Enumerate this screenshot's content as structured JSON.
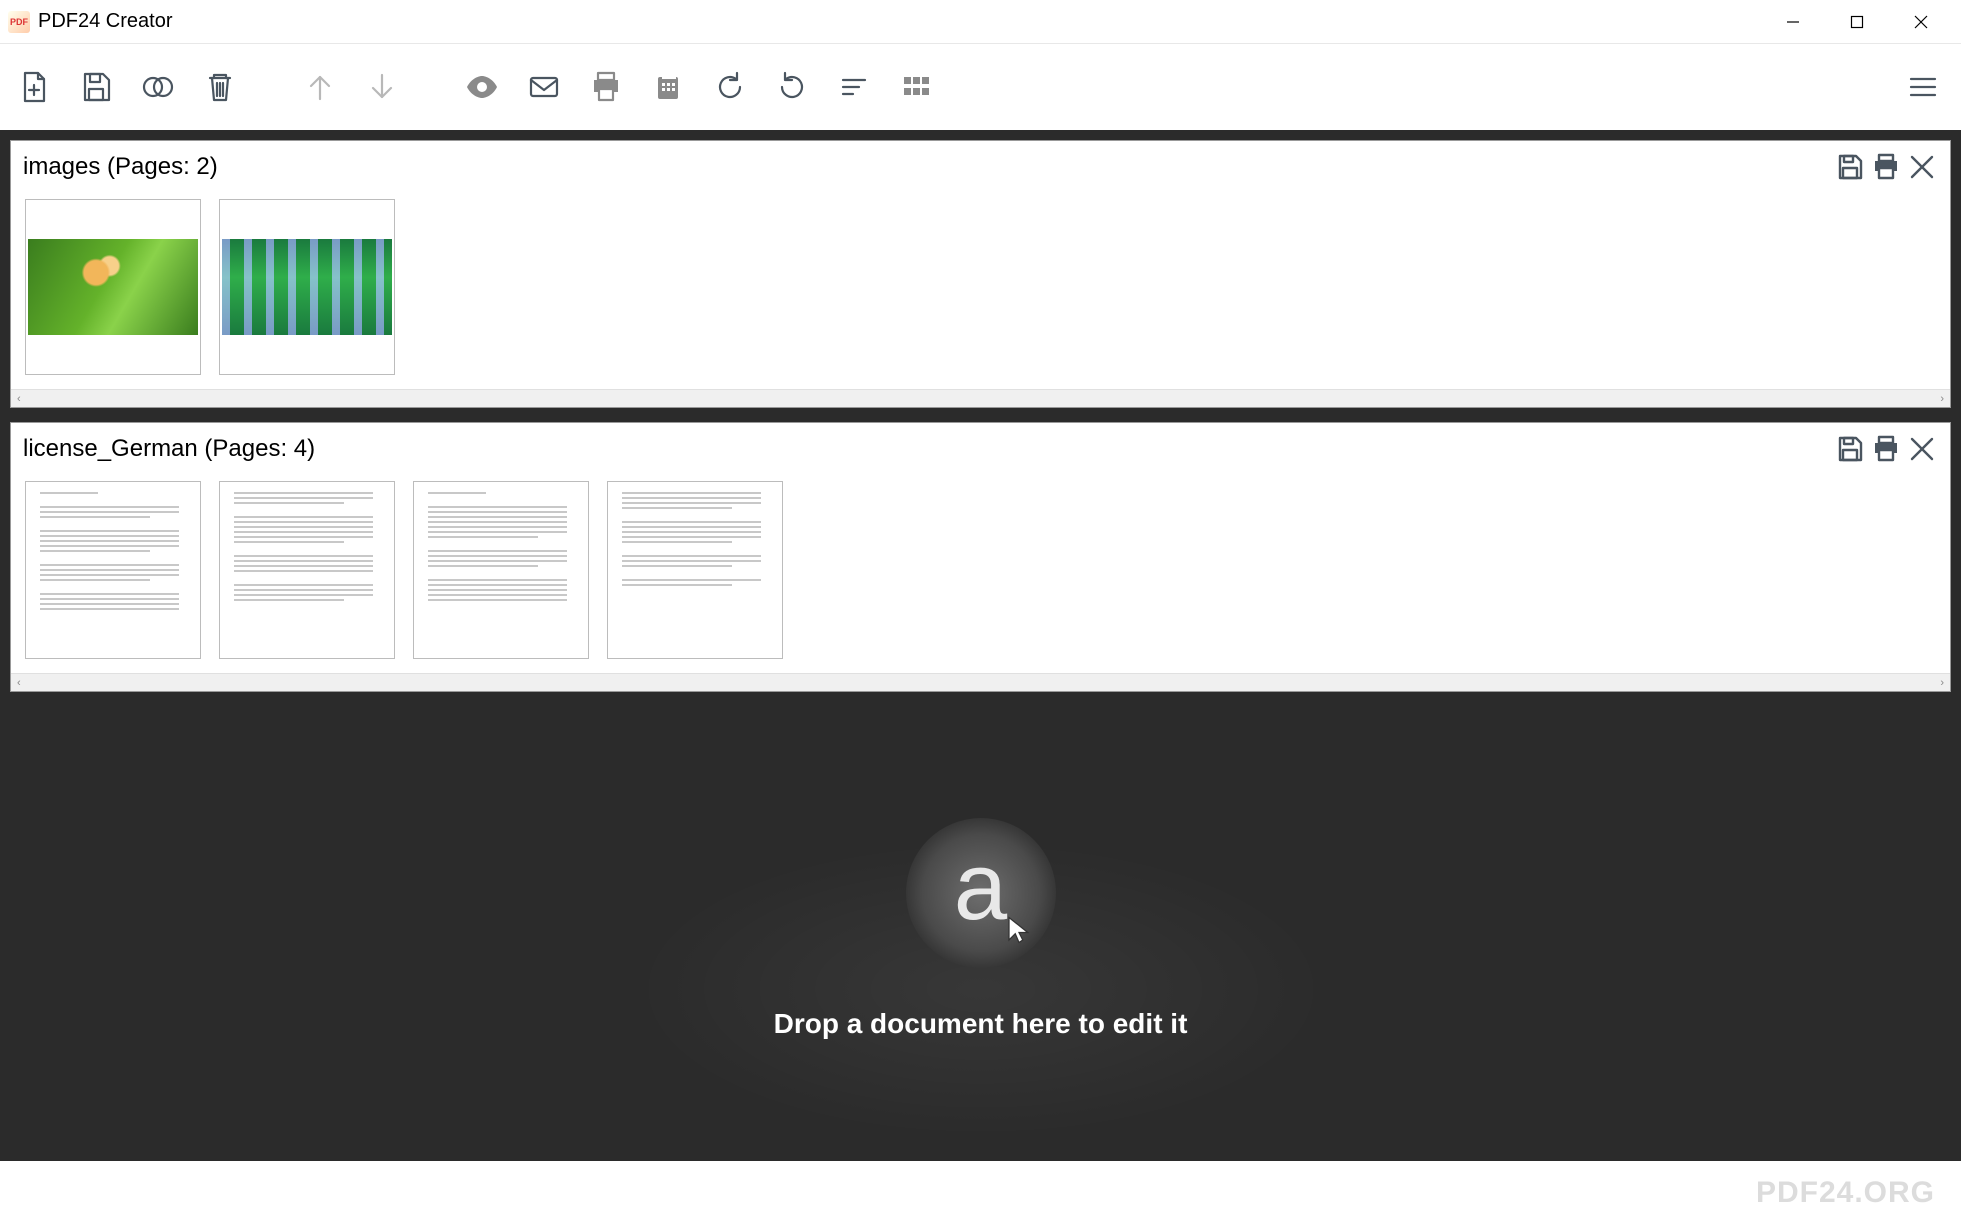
{
  "window": {
    "title": "PDF24 Creator"
  },
  "toolbar": {
    "new": "new-document",
    "save": "save",
    "merge": "merge",
    "delete": "delete",
    "up": "move-up",
    "down": "move-down",
    "preview": "preview",
    "email": "email",
    "print": "print",
    "fax": "fax",
    "rotate_ccw": "rotate-ccw",
    "rotate_cw": "rotate-cw",
    "sort": "sort",
    "grid": "grid-view",
    "menu": "menu"
  },
  "documents": [
    {
      "name": "images",
      "pages_label": "(Pages: 2)",
      "page_count": 2,
      "type": "images"
    },
    {
      "name": "license_German",
      "pages_label": "(Pages: 4)",
      "page_count": 4,
      "type": "text"
    }
  ],
  "dropzone": {
    "text": "Drop a document here to edit it"
  },
  "footer": {
    "brand": "PDF24.ORG"
  }
}
